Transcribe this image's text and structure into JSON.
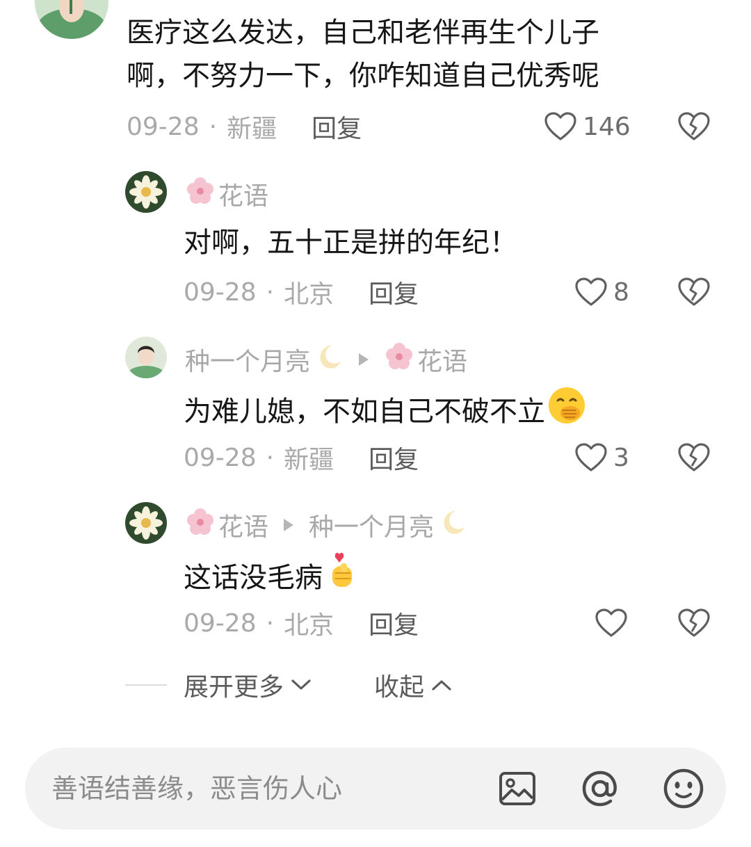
{
  "comments": [
    {
      "text_line1": "医疗这么发达，自己和老伴再生个儿子",
      "text_line2": "啊，不努力一下，你咋知道自己优秀呢",
      "date": "09-28",
      "location": "新疆",
      "reply_label": "回复",
      "likes": "146"
    }
  ],
  "replies": [
    {
      "author": "花语",
      "author_emoji": "flower",
      "text": "对啊，五十正是拼的年纪！",
      "date": "09-28",
      "location": "北京",
      "reply_label": "回复",
      "likes": "8"
    },
    {
      "author": "种一个月亮",
      "author_emoji": "moon",
      "reply_to": "花语",
      "text": "为难儿媳，不如自己不破不立",
      "text_emoji": "hand-over-mouth",
      "date": "09-28",
      "location": "新疆",
      "reply_label": "回复",
      "likes": "3"
    },
    {
      "author": "花语",
      "reply_to": "种一个月亮",
      "text": "这话没毛病",
      "text_emoji": "finger-heart",
      "date": "09-28",
      "location": "北京",
      "reply_label": "回复",
      "likes": ""
    }
  ],
  "thread_controls": {
    "expand_label": "展开更多",
    "collapse_label": "收起"
  },
  "input": {
    "placeholder": "善语结善缘，恶言伤人心",
    "icons": [
      "image-icon",
      "at-icon",
      "emoji-icon"
    ]
  },
  "colors": {
    "background": "#ffffff",
    "text": "#161616",
    "meta": "#a9a9a9",
    "input_bg": "#f2f2f2"
  }
}
